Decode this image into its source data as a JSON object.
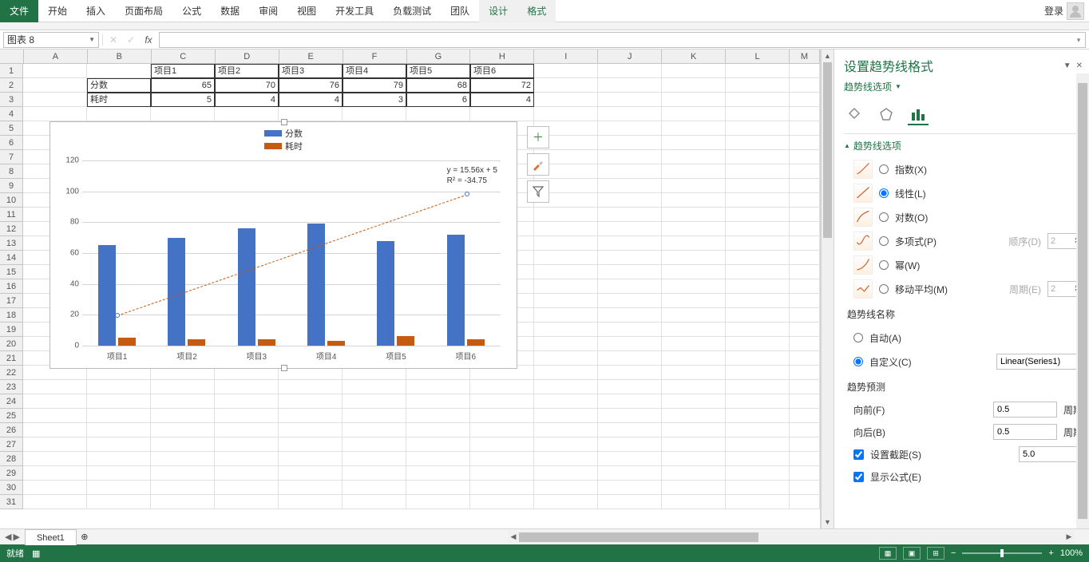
{
  "ribbon": {
    "tabs": [
      "文件",
      "开始",
      "插入",
      "页面布局",
      "公式",
      "数据",
      "审阅",
      "视图",
      "开发工具",
      "负载测试",
      "团队",
      "设计",
      "格式"
    ],
    "login": "登录"
  },
  "namebox": "图表 8",
  "columns": [
    "A",
    "B",
    "C",
    "D",
    "E",
    "F",
    "G",
    "H",
    "I",
    "J",
    "K",
    "L",
    "M"
  ],
  "data_cells": {
    "r1": [
      "",
      "",
      "项目1",
      "项目2",
      "项目3",
      "项目4",
      "项目5",
      "项目6"
    ],
    "r2": [
      "",
      "分数",
      "65",
      "70",
      "76",
      "79",
      "68",
      "72"
    ],
    "r3": [
      "",
      "耗时",
      "5",
      "4",
      "4",
      "3",
      "6",
      "4"
    ]
  },
  "chart_data": {
    "type": "bar",
    "categories": [
      "项目1",
      "项目2",
      "项目3",
      "项目4",
      "项目5",
      "项目6"
    ],
    "series": [
      {
        "name": "分数",
        "values": [
          65,
          70,
          76,
          79,
          68,
          72
        ],
        "color": "#4472c4"
      },
      {
        "name": "耗时",
        "values": [
          5,
          4,
          4,
          3,
          6,
          4
        ],
        "color": "#c55a11"
      }
    ],
    "ylim": [
      0,
      120
    ],
    "yticks": [
      0,
      20,
      40,
      60,
      80,
      100,
      120
    ],
    "trendline": {
      "equation": "y = 15.56x + 5",
      "r2": "R² = -34.75",
      "style": "linear-dashed",
      "color": "#c55a11"
    }
  },
  "chart_buttons": {
    "add": "+",
    "styles": "brush",
    "filter": "filter"
  },
  "pane": {
    "title": "设置趋势线格式",
    "subtitle": "趋势线选项",
    "section": "趋势线选项",
    "type_options": [
      {
        "key": "指数(X)",
        "checked": false
      },
      {
        "key": "线性(L)",
        "checked": true
      },
      {
        "key": "对数(O)",
        "checked": false
      },
      {
        "key": "多项式(P)",
        "checked": false,
        "extra_label": "顺序(D)",
        "extra_val": "2"
      },
      {
        "key": "幂(W)",
        "checked": false
      },
      {
        "key": "移动平均(M)",
        "checked": false,
        "extra_label": "周期(E)",
        "extra_val": "2"
      }
    ],
    "name_section": "趋势线名称",
    "name_auto": "自动(A)",
    "name_custom": "自定义(C)",
    "name_value": "Linear(Series1)",
    "forecast_section": "趋势预测",
    "forward_label": "向前(F)",
    "forward_val": "0.5",
    "backward_label": "向后(B)",
    "backward_val": "0.5",
    "period_label": "周期",
    "intercept_label": "设置截距(S)",
    "intercept_val": "5.0",
    "show_eq_label": "显示公式(E)"
  },
  "sheet_tabs": {
    "active": "Sheet1"
  },
  "status": {
    "ready": "就绪",
    "zoom": "100%"
  }
}
